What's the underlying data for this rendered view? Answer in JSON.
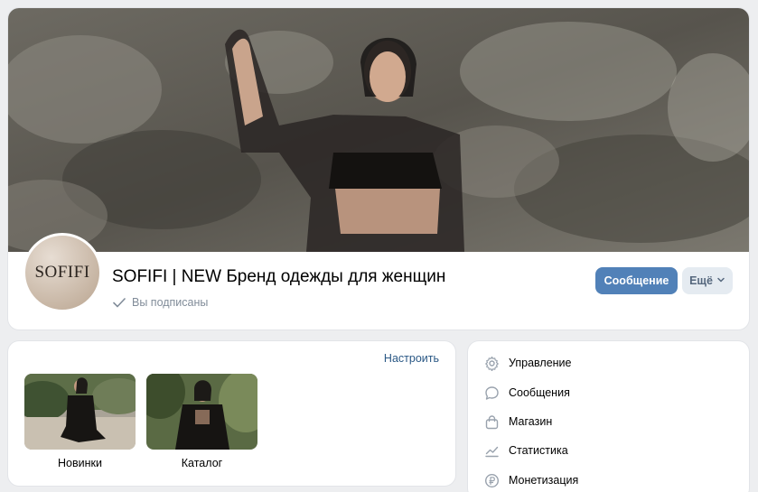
{
  "header": {
    "avatar_text": "SOFIFI",
    "title": "SOFIFI | NEW Бренд одежды для женщин",
    "subscribed_status": "Вы подписаны",
    "message_button": "Сообщение",
    "more_button": "Ещё"
  },
  "goods": {
    "configure_link": "Настроить",
    "albums": [
      {
        "label": "Новинки"
      },
      {
        "label": "Каталог"
      }
    ]
  },
  "menu": {
    "items": [
      {
        "label": "Управление",
        "icon": "gear-icon"
      },
      {
        "label": "Сообщения",
        "icon": "message-bubble-icon"
      },
      {
        "label": "Магазин",
        "icon": "shopping-bag-icon"
      },
      {
        "label": "Статистика",
        "icon": "chart-icon"
      },
      {
        "label": "Монетизация",
        "icon": "ruble-coin-icon"
      }
    ]
  },
  "colors": {
    "accent": "#5181b8",
    "link": "#2a5885",
    "secondary_text": "#818c99",
    "page_background": "#edeef0"
  }
}
